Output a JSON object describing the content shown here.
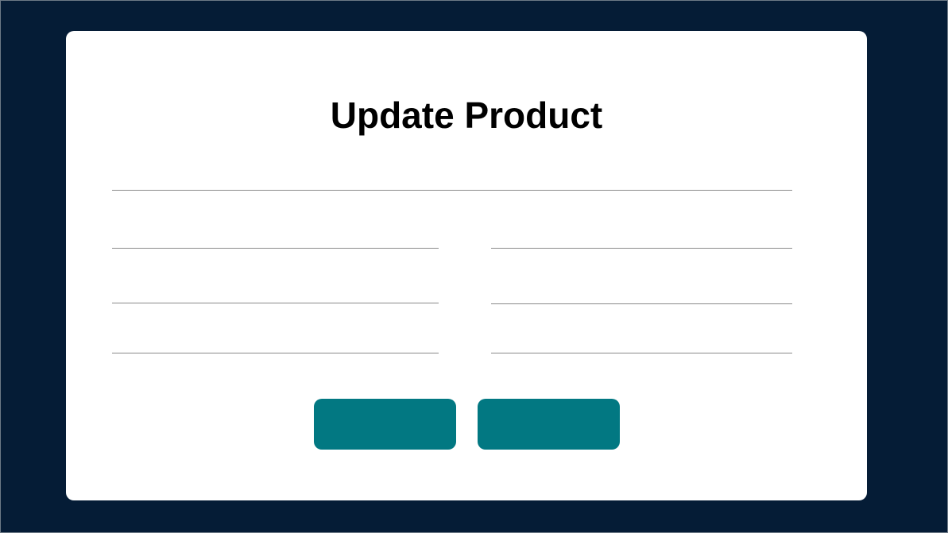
{
  "form": {
    "title": "Update Product",
    "fields": {
      "name": {
        "value": "",
        "placeholder": ""
      },
      "left_1": {
        "value": "",
        "placeholder": ""
      },
      "right_1": {
        "value": "",
        "placeholder": ""
      },
      "left_2": {
        "value": "",
        "placeholder": ""
      },
      "right_2": {
        "value": "",
        "placeholder": ""
      },
      "left_3": {
        "value": "",
        "placeholder": ""
      },
      "right_3": {
        "value": "",
        "placeholder": ""
      }
    },
    "buttons": {
      "primary_label": "",
      "secondary_label": ""
    }
  },
  "colors": {
    "background": "#051c36",
    "card": "#ffffff",
    "button": "#027882",
    "field_underline": "#8a8a8a"
  }
}
